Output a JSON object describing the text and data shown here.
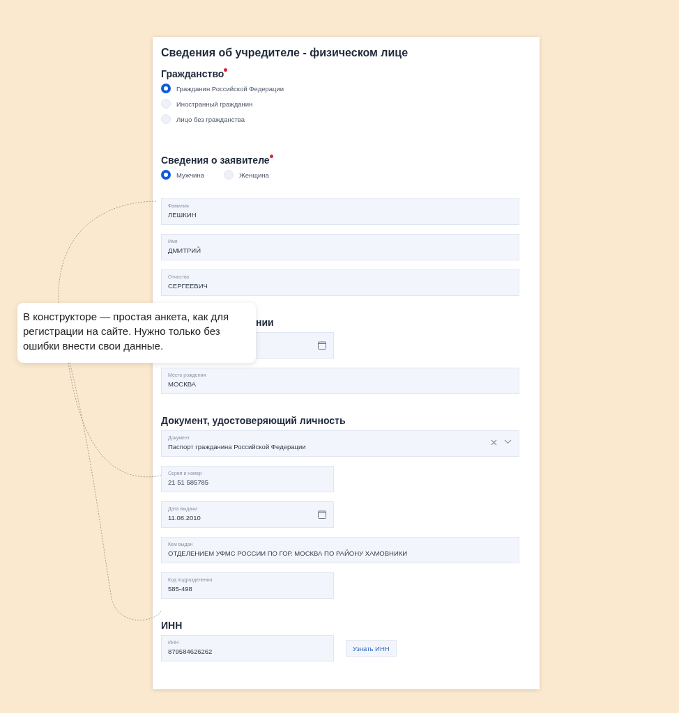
{
  "title": "Сведения об учредителе - физическом лице",
  "sections": [
    {
      "heading": "Гражданство",
      "required": true,
      "fields": [
        {
          "kind": "radio_group",
          "vertical": true,
          "options": [
            {
              "label": "Гражданин Российской Федерации",
              "selected": true
            },
            {
              "label": "Иностранный гражданин",
              "selected": false
            },
            {
              "label": "Лицо без гражданства",
              "selected": false
            }
          ]
        }
      ]
    },
    {
      "heading": "Сведения о заявителе",
      "required": true,
      "fields": [
        {
          "kind": "radio_group",
          "vertical": false,
          "options": [
            {
              "label": "Мужчина",
              "selected": true
            },
            {
              "label": "Женщина",
              "selected": false
            }
          ]
        },
        {
          "kind": "text",
          "wide": true,
          "label": "Фамилия",
          "value": "ЛЕШКИН"
        },
        {
          "kind": "text",
          "wide": true,
          "label": "Имя",
          "value": "ДМИТРИЙ"
        },
        {
          "kind": "text",
          "wide": true,
          "label": "Отчество",
          "value": "СЕРГЕЕВИЧ"
        }
      ]
    },
    {
      "heading": "нии",
      "required": false,
      "clipped": true,
      "fields": [
        {
          "kind": "date",
          "wide": false
        },
        {
          "kind": "text",
          "wide": true,
          "label": "Место рождения",
          "value": "МОСКВА"
        }
      ]
    },
    {
      "heading": "Документ, удостоверяющий личность",
      "required": false,
      "fields": [
        {
          "kind": "select",
          "wide": true,
          "label": "Документ",
          "value": "Паспорт гражданина Российской Федерации"
        },
        {
          "kind": "text",
          "wide": false,
          "label": "Серия и номер",
          "value": "21 51 585785"
        },
        {
          "kind": "date",
          "wide": false,
          "label": "Дата выдачи",
          "value": "11.08.2010"
        },
        {
          "kind": "text",
          "wide": true,
          "label": "Кем выдан",
          "value": "ОТДЕЛЕНИЕМ УФМС РОССИИ ПО ГОР. МОСКВА ПО РАЙОНУ ХАМОВНИКИ"
        },
        {
          "kind": "text",
          "wide": false,
          "label": "Код подразделения",
          "value": "585-498"
        }
      ]
    },
    {
      "heading": "ИНН",
      "required": false,
      "fields": [
        {
          "kind": "text_with_button",
          "wide": false,
          "label": "ИНН",
          "value": "879584626262",
          "button": "Узнать ИНН"
        }
      ]
    }
  ],
  "callout": {
    "text": "В конструкторе — простая  анкета, как для регистрации на сайте. Нужно только без ошибки внести свои данные."
  }
}
